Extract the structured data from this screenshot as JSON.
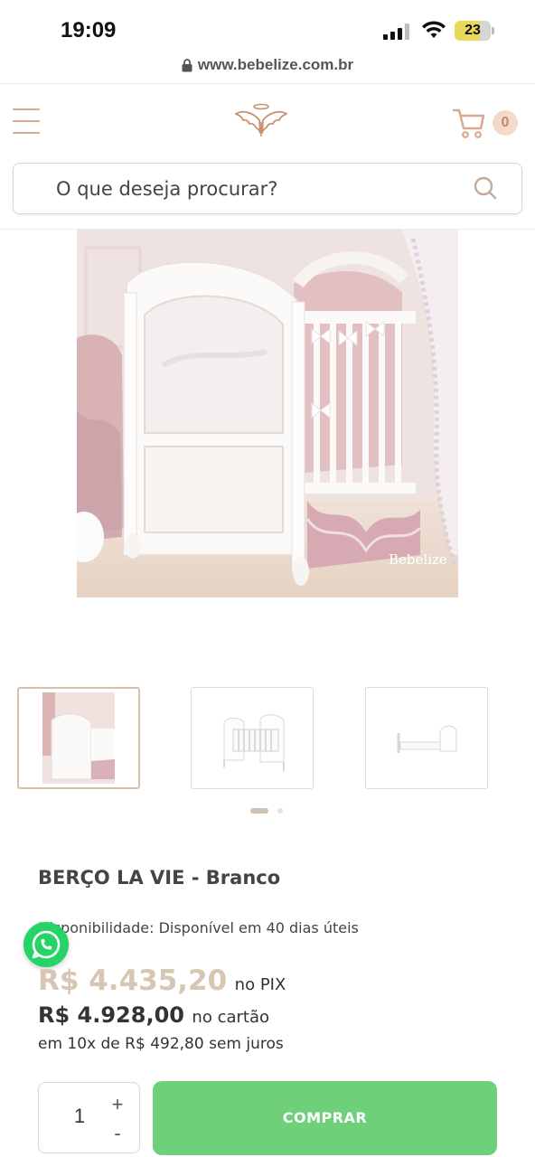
{
  "status_bar": {
    "time": "19:09",
    "battery": "23"
  },
  "browser": {
    "url": "www.bebelize.com.br"
  },
  "header": {
    "cart_count": "0",
    "icons": [
      "menu-icon",
      "angel-wings-logo",
      "cart-icon"
    ]
  },
  "search": {
    "placeholder": "O que deseja procurar?"
  },
  "gallery": {
    "main_image_watermark": "Bebelize",
    "thumbnail_count": 3,
    "active_thumbnail": 1,
    "pagination_dots": 2
  },
  "product": {
    "title": "BERÇO LA VIE - Branco",
    "availability_label": "Disponibilidade:",
    "availability_value": "Disponível em 40 dias úteis",
    "price_pix": "R$ 4.435,20",
    "price_pix_suffix": "no PIX",
    "price_card": "R$ 4.928,00",
    "price_card_suffix": "no cartão",
    "installments": "em 10x de R$ 492,80 sem juros"
  },
  "purchase": {
    "quantity": "1",
    "plus_label": "+",
    "minus_label": "-",
    "buy_label": "COMPRAR"
  },
  "colors": {
    "accent": "#d9a990",
    "buy_button": "#6fd07a",
    "pix_price": "#d6c6b2",
    "whatsapp": "#25d366"
  }
}
